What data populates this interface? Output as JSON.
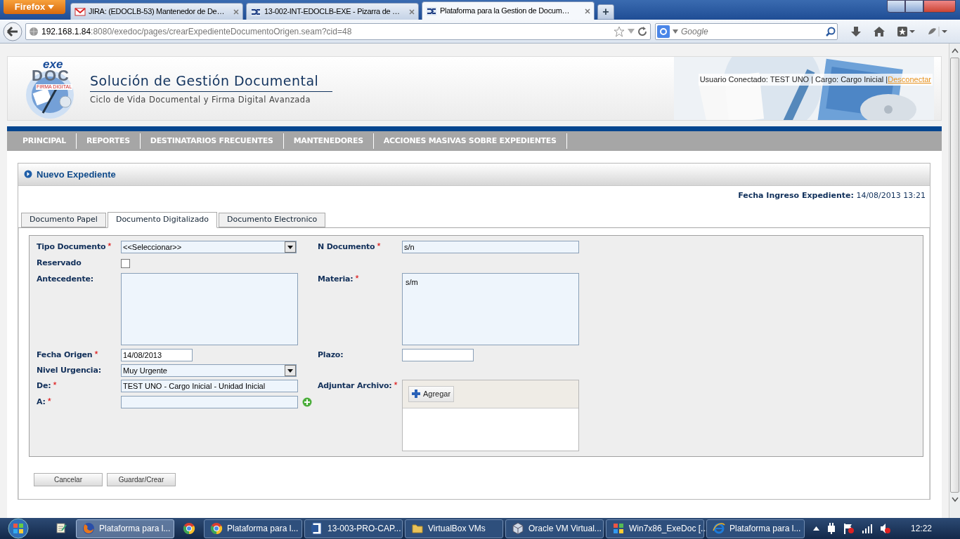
{
  "browser": {
    "menu_button": "Firefox",
    "tabs": [
      {
        "title": "JIRA: (EDOCLB-53) Mantenedor de De…",
        "selected": false
      },
      {
        "title": "13-002-INT-EDOCLB-EXE - Pizarra de …",
        "selected": false
      },
      {
        "title": "Plataforma para la Gestion de Docum…",
        "selected": true
      }
    ],
    "new_tab": "+",
    "url": {
      "host": "192.168.1.84",
      "rest": ":8080/exedoc/pages/crearExpedienteDocumentoOrigen.seam?cid=48"
    },
    "search_placeholder": "Google"
  },
  "header": {
    "logo": {
      "top": "exe",
      "main": "DOC",
      "tagline": "FIRMA DIGITAL"
    },
    "title": "Solución de Gestión Documental",
    "subtitle": "Ciclo de Vida Documental y Firma Digital Avanzada",
    "user_info": "Usuario Conectado: TEST UNO | Cargo: Cargo Inicial |",
    "logout": "Desconectar"
  },
  "menu": [
    "PRINCIPAL",
    "REPORTES",
    "DESTINATARIOS FRECUENTES",
    "MANTENEDORES",
    "ACCIONES MASIVAS SOBRE EXPEDIENTES"
  ],
  "panel": {
    "title": "Nuevo Expediente",
    "entry_date_label": "Fecha Ingreso Expediente:",
    "entry_date": "14/08/2013 13:21",
    "tabs": [
      {
        "label": "Documento Papel",
        "selected": false
      },
      {
        "label": "Documento Digitalizado",
        "selected": true
      },
      {
        "label": "Documento Electronico",
        "selected": false
      }
    ],
    "rows": [
      {
        "left": {
          "label": "Tipo Documento",
          "required_mark": "*",
          "kind": "select",
          "value": "<<Seleccionar>>"
        },
        "right": {
          "label": "N Documento",
          "required_mark": "*",
          "kind": "text",
          "value": "s/n"
        }
      },
      {
        "left": {
          "label": "Reservado",
          "kind": "checkbox",
          "checked": false
        }
      },
      {
        "left": {
          "label": "Antecedente:",
          "kind": "textarea"
        },
        "right": {
          "label": "Materia:",
          "required_mark": "*",
          "kind": "textarea",
          "value": "s/m"
        }
      },
      {
        "left": {
          "label": "Fecha Origen",
          "required_mark": "*",
          "kind": "date",
          "value": "14/08/2013"
        },
        "right": {
          "label": "Plazo:",
          "kind": "short"
        }
      },
      {
        "left": {
          "label": "Nivel Urgencia:",
          "kind": "select",
          "value": "Muy Urgente"
        }
      },
      {
        "left": {
          "label": "De:",
          "required_mark": "*",
          "kind": "readonly",
          "value": "TEST UNO - Cargo Inicial - Unidad Inicial"
        },
        "right": {
          "label": "Adjuntar Archivo:",
          "required_mark": "*",
          "kind": "upload",
          "button": "Agregar"
        }
      },
      {
        "left": {
          "label": "A:",
          "required_mark": "*",
          "kind": "add"
        }
      }
    ],
    "buttons": [
      "Cancelar",
      "Guardar/Crear"
    ]
  },
  "taskbar": {
    "items": [
      {
        "active": false
      },
      {
        "label": "Plataforma para l...",
        "active": true
      },
      {
        "active": false
      },
      {
        "label": "Plataforma para l...",
        "active": false
      },
      {
        "label": "13-003-PRO-CAP...",
        "active": false
      },
      {
        "label": "VirtualBox VMs",
        "active": false
      },
      {
        "label": "Oracle VM Virtual...",
        "active": false
      },
      {
        "label": "Win7x86_ExeDoc [...",
        "active": false
      },
      {
        "label": "Plataforma para l...",
        "active": false
      }
    ],
    "clock": "12:22"
  }
}
